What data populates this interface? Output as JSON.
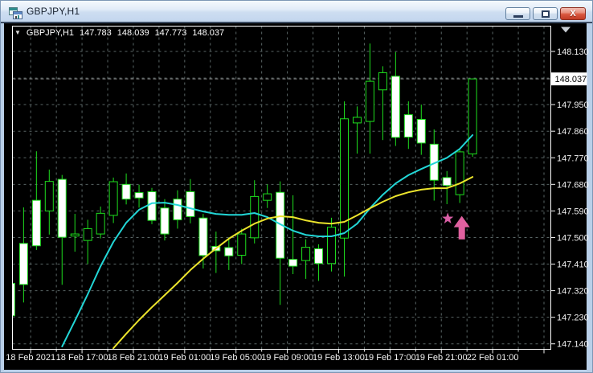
{
  "window": {
    "title": "GBPJPY,H1",
    "buttons": {
      "minimize": "minimize",
      "maximize": "maximize",
      "close": "close"
    }
  },
  "quote_line": {
    "symbol": "GBPJPY,H1",
    "open": "147.783",
    "high": "148.039",
    "low": "147.773",
    "close": "148.037"
  },
  "price_axis": {
    "current_price_label": "148.037",
    "visible_labels": [
      "148.130",
      "147.950",
      "147.860",
      "147.770",
      "147.680",
      "147.590",
      "147.500",
      "147.410",
      "147.320",
      "147.230",
      "147.140"
    ]
  },
  "colors": {
    "background": "#000000",
    "grid": "#5a6666",
    "candle_line": "#1ede1e",
    "bull_fill": "#000000",
    "bear_fill": "#ffffff",
    "ma_cyan": "#22d6d6",
    "ma_yellow": "#ece42c",
    "annotation_pink": "#e0609f",
    "annotation_star": "#d95fa6",
    "price_line": "#8c8c8c",
    "axis_text": "#f2f2f2",
    "tag_bg": "#ffffff",
    "tag_text": "#000000",
    "border": "#ffffff",
    "shift_marker": "#c9ced4"
  },
  "chart_data": {
    "type": "candlestick",
    "symbol": "GBPJPY",
    "timeframe": "H1",
    "title": "GBPJPY,H1",
    "price_grid": {
      "max": 148.13,
      "step": 0.09,
      "count": 12
    },
    "current_price": 148.037,
    "ylim": [
      147.1,
      148.21
    ],
    "x_labels": [
      "18 Feb 2021",
      "18 Feb 17:00",
      "18 Feb 21:00",
      "19 Feb 01:00",
      "19 Feb 05:00",
      "19 Feb 09:00",
      "19 Feb 13:00",
      "19 Feb 17:00",
      "19 Feb 21:00",
      "22 Feb 01:00"
    ],
    "candles": [
      [
        147.345,
        147.355,
        147.225,
        147.235
      ],
      [
        147.48,
        147.602,
        147.28,
        147.341
      ],
      [
        147.626,
        147.792,
        147.458,
        147.472
      ],
      [
        147.59,
        147.73,
        147.51,
        147.69
      ],
      [
        147.697,
        147.712,
        147.34,
        147.501
      ],
      [
        147.505,
        147.58,
        147.452,
        147.512
      ],
      [
        147.49,
        147.56,
        147.41,
        147.53
      ],
      [
        147.512,
        147.605,
        147.497,
        147.582
      ],
      [
        147.575,
        147.703,
        147.549,
        147.689
      ],
      [
        147.68,
        147.717,
        147.612,
        147.63
      ],
      [
        147.652,
        147.679,
        147.601,
        147.634
      ],
      [
        147.655,
        147.668,
        147.545,
        147.558
      ],
      [
        147.6,
        147.63,
        147.49,
        147.512
      ],
      [
        147.63,
        147.66,
        147.53,
        147.56
      ],
      [
        147.655,
        147.698,
        147.548,
        147.571
      ],
      [
        147.566,
        147.58,
        147.395,
        147.439
      ],
      [
        147.47,
        147.52,
        147.38,
        147.455
      ],
      [
        147.466,
        147.5,
        147.39,
        147.438
      ],
      [
        147.44,
        147.53,
        147.41,
        147.512
      ],
      [
        147.499,
        147.694,
        147.48,
        147.639
      ],
      [
        147.626,
        147.68,
        147.6,
        147.648
      ],
      [
        147.653,
        147.69,
        147.272,
        147.43
      ],
      [
        147.426,
        147.643,
        147.376,
        147.403
      ],
      [
        147.422,
        147.494,
        147.36,
        147.467
      ],
      [
        147.462,
        147.477,
        147.353,
        147.412
      ],
      [
        147.412,
        147.567,
        147.385,
        147.535
      ],
      [
        147.498,
        147.961,
        147.368,
        147.902
      ],
      [
        147.888,
        147.944,
        147.784,
        147.907
      ],
      [
        147.893,
        148.157,
        147.784,
        148.029
      ],
      [
        148.0,
        148.08,
        147.83,
        148.058
      ],
      [
        148.046,
        148.128,
        147.81,
        147.839
      ],
      [
        147.916,
        147.961,
        147.8,
        147.84
      ],
      [
        147.9,
        147.95,
        147.78,
        147.82
      ],
      [
        147.816,
        147.866,
        147.625,
        147.694
      ],
      [
        147.703,
        147.725,
        147.613,
        147.676
      ],
      [
        147.645,
        147.8,
        147.617,
        147.79
      ],
      [
        147.783,
        148.039,
        147.773,
        148.037
      ]
    ],
    "series": [
      {
        "name": "ma-cyan",
        "start_index": 4,
        "values": [
          147.131,
          147.218,
          147.308,
          147.403,
          147.485,
          147.55,
          147.594,
          147.616,
          147.618,
          147.61,
          147.599,
          147.588,
          147.58,
          147.577,
          147.577,
          147.583,
          147.569,
          147.545,
          147.523,
          147.509,
          147.504,
          147.504,
          147.515,
          147.547,
          147.599,
          147.645,
          147.683,
          147.711,
          147.732,
          147.751,
          147.77,
          147.8,
          147.847
        ]
      },
      {
        "name": "ma-yellow",
        "start_index": 8,
        "values": [
          147.125,
          147.174,
          147.221,
          147.264,
          147.305,
          147.346,
          147.39,
          147.428,
          147.463,
          147.496,
          147.523,
          147.547,
          147.564,
          147.572,
          147.569,
          147.558,
          147.55,
          147.547,
          147.553,
          147.575,
          147.599,
          147.621,
          147.64,
          147.653,
          147.662,
          147.667,
          147.667,
          147.683,
          147.705
        ]
      }
    ],
    "annotations": {
      "star": {
        "index": 34,
        "price": 147.564
      },
      "arrow_up": {
        "index": 35,
        "tip_price": 147.573,
        "base_price": 147.494
      }
    }
  }
}
